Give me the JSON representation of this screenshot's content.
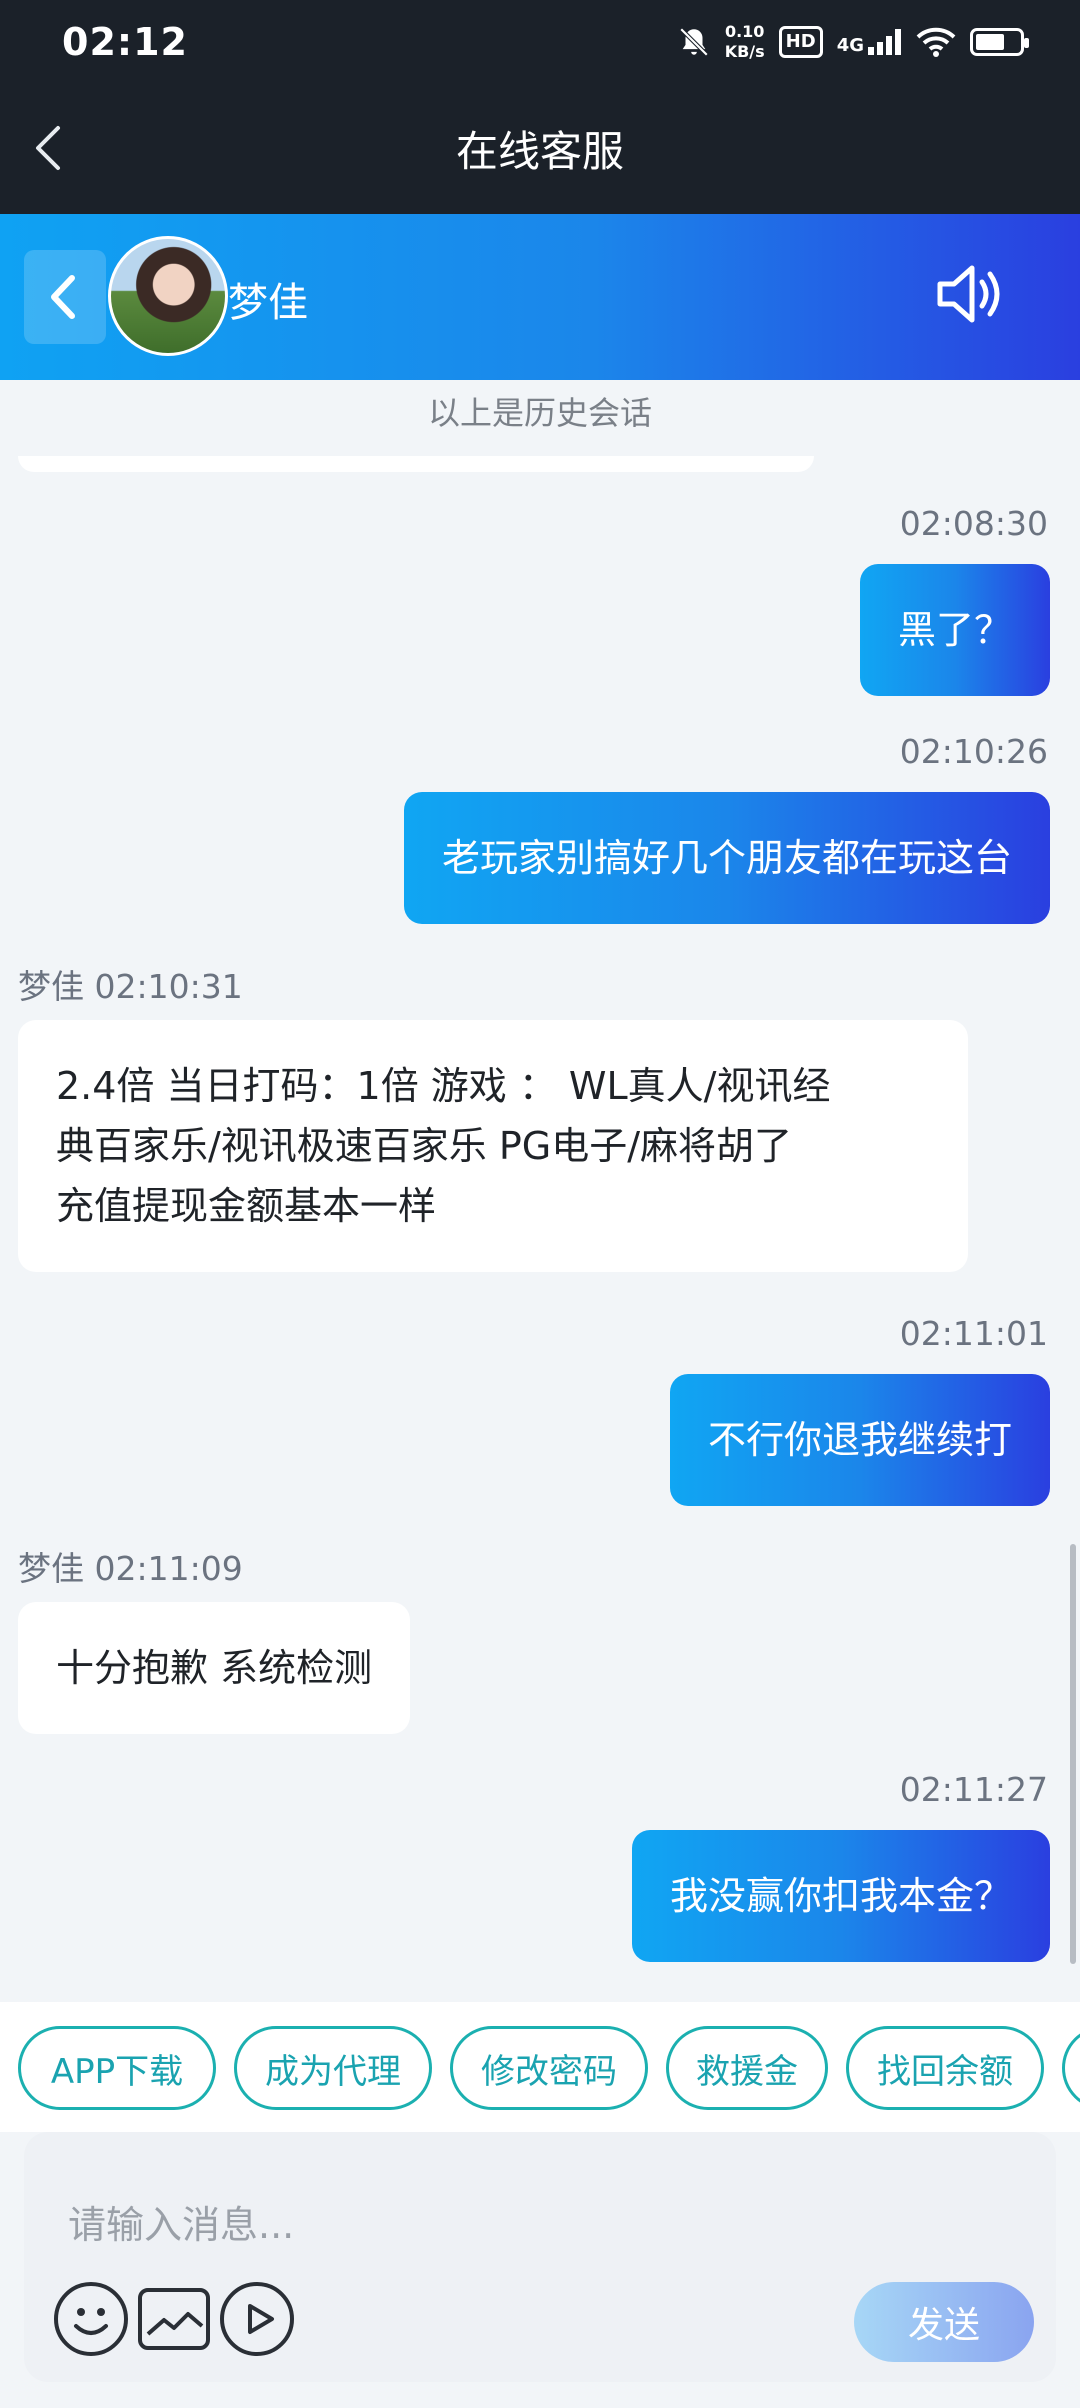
{
  "status_bar": {
    "time": "02:12",
    "net_speed_value": "0.10",
    "net_speed_unit": "KB/s",
    "hd": "HD",
    "network": "4G",
    "icons": [
      "mute-bell-icon",
      "hd-icon",
      "signal-icon",
      "wifi-icon",
      "battery-icon"
    ]
  },
  "title_bar": {
    "title": "在线客服",
    "back_icon": "chevron-left-icon"
  },
  "chat_header": {
    "agent_name": "梦佳",
    "icons": [
      "chevron-left-icon",
      "avatar",
      "speaker-icon"
    ]
  },
  "chat": {
    "history_label": "以上是历史会话",
    "messages": [
      {
        "side": "me",
        "time": "02:08:30",
        "text": "黑了？"
      },
      {
        "side": "me",
        "time": "02:10:26",
        "text": "老玩家别搞好几个朋友都在玩这台"
      },
      {
        "side": "them",
        "sender": "梦佳",
        "time": "02:10:31",
        "lines": [
          "2.4倍 当日打码：1倍  游戏 ： WL真人/视讯经",
          "典百家乐/视讯极速百家乐   PG电子/麻将胡了",
          "充值提现金额基本一样"
        ]
      },
      {
        "side": "me",
        "time": "02:11:01",
        "text": "不行你退我继续打"
      },
      {
        "side": "them",
        "sender": "梦佳",
        "time": "02:11:09",
        "lines": [
          "十分抱歉 系统检测"
        ]
      },
      {
        "side": "me",
        "time": "02:11:27",
        "text": "我没赢你扣我本金？"
      }
    ]
  },
  "quick_actions": [
    "APP下载",
    "成为代理",
    "修改密码",
    "救援金",
    "找回余额"
  ],
  "composer": {
    "placeholder": "请输入消息...",
    "send_label": "发送",
    "tools": [
      "emoji-icon",
      "image-icon",
      "video-icon"
    ]
  },
  "colors": {
    "accent_gradient_start": "#0fa2f3",
    "accent_gradient_end": "#2a3fe0",
    "chip_border": "#1bb0b0",
    "dark_bar": "#1b2129"
  }
}
